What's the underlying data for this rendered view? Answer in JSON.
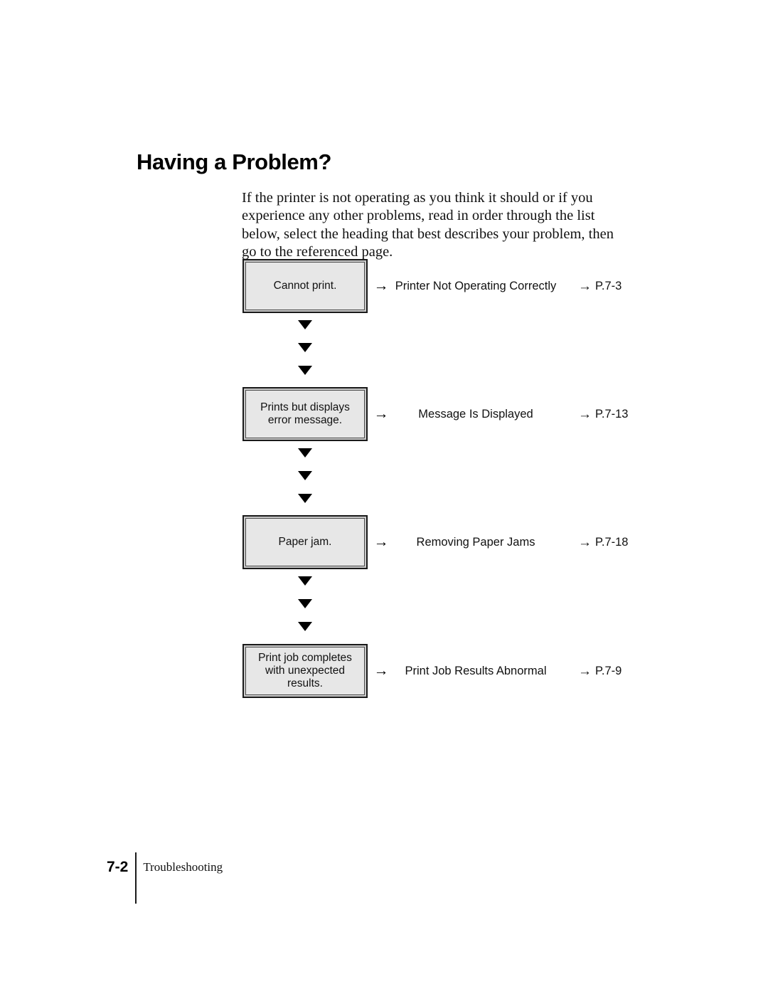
{
  "document": {
    "title": "Having a Problem?",
    "intro_paragraph": "If the printer is not operating as you think it should or if you experience any other problems, read in order through the list below, select the heading that best describes your problem, then go to the referenced page."
  },
  "flowchart": {
    "connector_arrow": "→",
    "reference_arrow": "→",
    "down_marker": "▼",
    "rows": [
      {
        "symptom": "Cannot print.",
        "heading": "Printer Not Operating Correctly",
        "page_reference": "P.7-3"
      },
      {
        "symptom": "Prints but displays error message.",
        "heading": "Message Is Displayed",
        "page_reference": "P.7-13"
      },
      {
        "symptom": "Paper jam.",
        "heading": "Removing Paper Jams",
        "page_reference": "P.7-18"
      },
      {
        "symptom": "Print job completes with unexpected results.",
        "heading": "Print Job Results Abnormal",
        "page_reference": "P.7-9"
      }
    ]
  },
  "footer": {
    "page_number": "7-2",
    "section_name": "Troubleshooting"
  },
  "colors": {
    "box_fill": "#e7e7e7",
    "box_border_outer": "#1a1a1a",
    "box_border_inner": "#4a4a4a",
    "text": "#111111",
    "page_background": "#ffffff"
  }
}
